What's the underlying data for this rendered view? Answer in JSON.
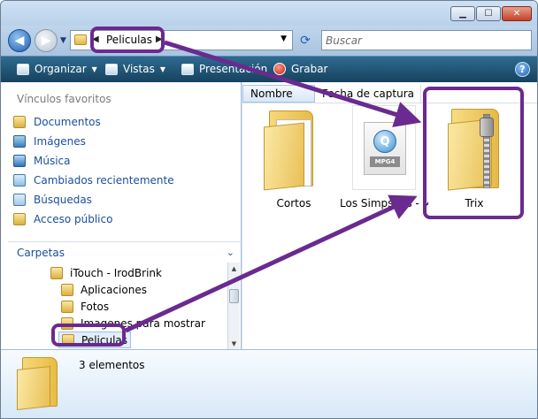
{
  "address": {
    "path": "Peliculas",
    "search_placeholder": "Buscar"
  },
  "toolbar": {
    "organize": "Organizar",
    "views": "Vistas",
    "presentation": "Presentación",
    "record": "Grabar"
  },
  "sidebar": {
    "favorites_header": "Vínculos favoritos",
    "favorites": [
      {
        "label": "Documentos",
        "icon": "folder-icon"
      },
      {
        "label": "Imágenes",
        "icon": "pictures-icon"
      },
      {
        "label": "Música",
        "icon": "music-icon"
      },
      {
        "label": "Cambiados recientemente",
        "icon": "recent-icon"
      },
      {
        "label": "Búsquedas",
        "icon": "search-folder-icon"
      },
      {
        "label": "Acceso público",
        "icon": "folder-icon"
      }
    ],
    "folders_header": "Carpetas",
    "tree": [
      {
        "label": "iTouch - IrodBrink",
        "indent": 1
      },
      {
        "label": "Aplicaciones",
        "indent": 2
      },
      {
        "label": "Fotos",
        "indent": 2
      },
      {
        "label": "Imagenes para mostrar",
        "indent": 2
      },
      {
        "label": "Peliculas",
        "indent": 2,
        "selected": true
      }
    ]
  },
  "columns": {
    "name": "Nombre",
    "date": "Fecha de captura"
  },
  "files": [
    {
      "name": "Cortos",
      "type": "folder"
    },
    {
      "name": "Los Simpsons - Movie",
      "type": "mpg4",
      "tag": "MPG4"
    },
    {
      "name": "Trix",
      "type": "zip"
    }
  ],
  "details": {
    "count": "3 elementos"
  },
  "colors": {
    "annotation": "#6a2a8f",
    "toolbar": "#1f5675",
    "link": "#1a4fa0"
  }
}
